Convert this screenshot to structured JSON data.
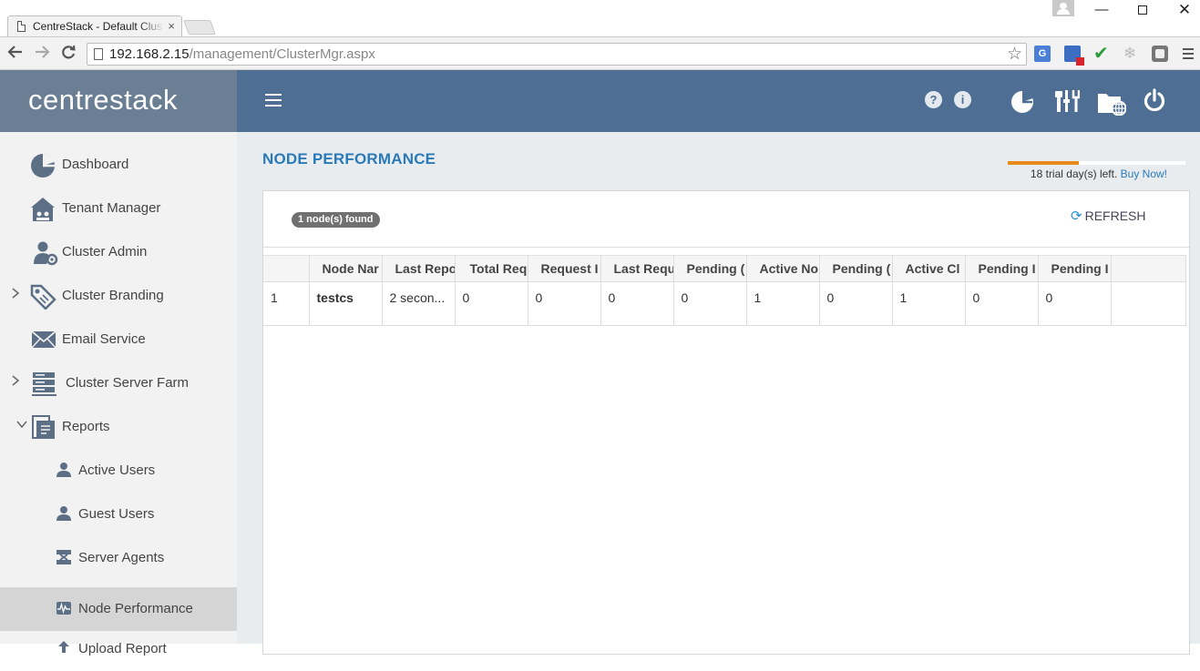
{
  "browser": {
    "tab_title": "CentreStack - Default Clus",
    "tab_close": "×",
    "url_host": "192.168.2.15",
    "url_path": "/management/ClusterMgr.aspx",
    "window_min": "—",
    "window_close": "✕",
    "ext_translate": "G"
  },
  "header": {
    "brand": "centrestack",
    "help_glyph": "?",
    "info_glyph": "i"
  },
  "sidebar": {
    "items": [
      {
        "label": "Dashboard",
        "icon": "dashboard-icon"
      },
      {
        "label": "Tenant Manager",
        "icon": "tenant-icon"
      },
      {
        "label": "Cluster Admin",
        "icon": "cluster-admin-icon"
      },
      {
        "label": "Cluster Branding",
        "icon": "branding-icon",
        "caret": "›"
      },
      {
        "label": "Email Service",
        "icon": "email-icon"
      },
      {
        "label": "Cluster Server Farm",
        "icon": "server-farm-icon",
        "caret": "›"
      },
      {
        "label": "Reports",
        "icon": "reports-icon",
        "caret": "⌄"
      },
      {
        "label": "Active Users",
        "icon": "user-icon"
      },
      {
        "label": "Guest Users",
        "icon": "user-icon"
      },
      {
        "label": "Server Agents",
        "icon": "server-agent-icon"
      },
      {
        "label": "Node Performance",
        "icon": "performance-icon"
      },
      {
        "label": "Upload Report",
        "icon": "upload-icon"
      }
    ]
  },
  "main": {
    "title": "NODE PERFORMANCE",
    "trial": {
      "text": "18 trial day(s) left.",
      "link": "Buy Now!",
      "progress": 0.4
    },
    "found_badge": "1 node(s) found",
    "refresh_label": "REFRESH",
    "refresh_glyph": "⟳",
    "table": {
      "headers": [
        "",
        "Node Nar",
        "Last Repo",
        "Total Req",
        "Request I",
        "Last Requ",
        "Pending (",
        "Active No",
        "Pending (",
        "Active Cl",
        "Pending I",
        "Pending I",
        ""
      ],
      "rows": [
        [
          "1",
          "testcs",
          "2 secon...",
          "0",
          "0",
          "0",
          "0",
          "1",
          "0",
          "1",
          "0",
          "0",
          ""
        ]
      ]
    }
  },
  "colors": {
    "accent": "#2a7ab8",
    "header_bar": "#4e6f93",
    "brand_bg": "#6a7f94",
    "trial_progress": "#e88a1a"
  }
}
